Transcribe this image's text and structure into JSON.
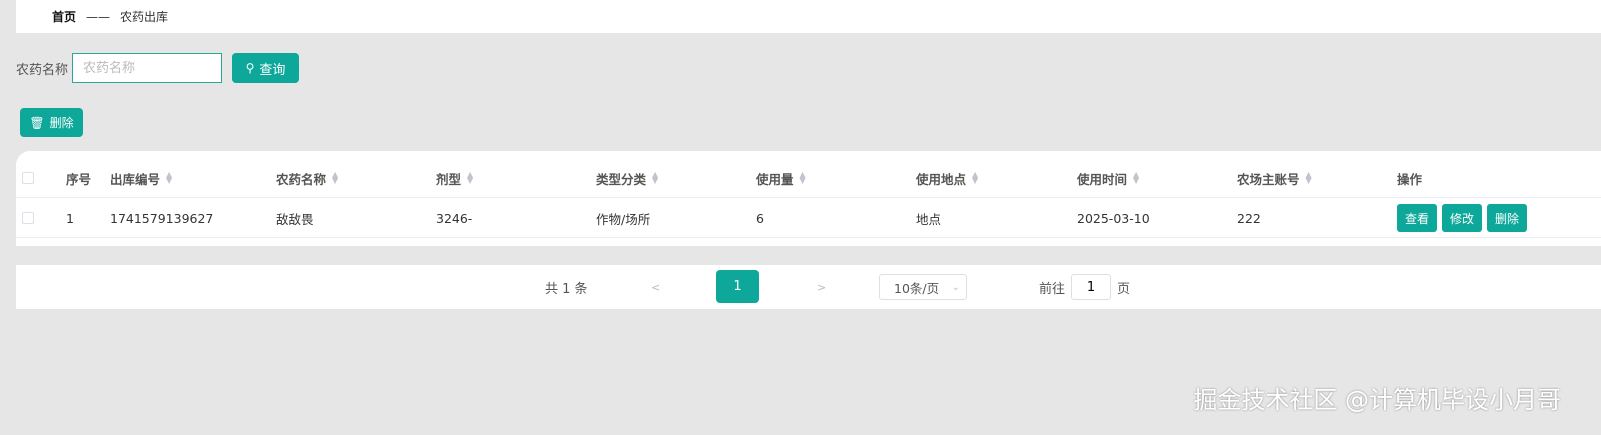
{
  "breadcrumb": {
    "home": "首页",
    "separator": "——",
    "current": "农药出库"
  },
  "search": {
    "label": "农药名称",
    "placeholder": "农药名称",
    "value": "",
    "button": "查询"
  },
  "toolbar": {
    "delete": "删除"
  },
  "table": {
    "columns": [
      "序号",
      "出库编号",
      "农药名称",
      "剂型",
      "类型分类",
      "使用量",
      "使用地点",
      "使用时间",
      "农场主账号",
      "操作"
    ],
    "rows": [
      {
        "index": "1",
        "out_no": "1741579139627",
        "name": "敌敌畏",
        "form": "3246-",
        "category": "作物/场所",
        "amount": "6",
        "location": "地点",
        "time": "2025-03-10",
        "account": "222"
      }
    ],
    "actions": [
      "查看",
      "修改",
      "删除"
    ]
  },
  "pagination": {
    "total": "共 1 条",
    "prev": "<",
    "current": "1",
    "next": ">",
    "page_size": "10条/页",
    "goto_label": "前往",
    "goto_value": "1",
    "page_suffix": "页"
  },
  "watermark": "掘金技术社区 @计算机毕设小月哥",
  "colors": {
    "accent": "#0da89a",
    "background": "#e6e6e6"
  }
}
